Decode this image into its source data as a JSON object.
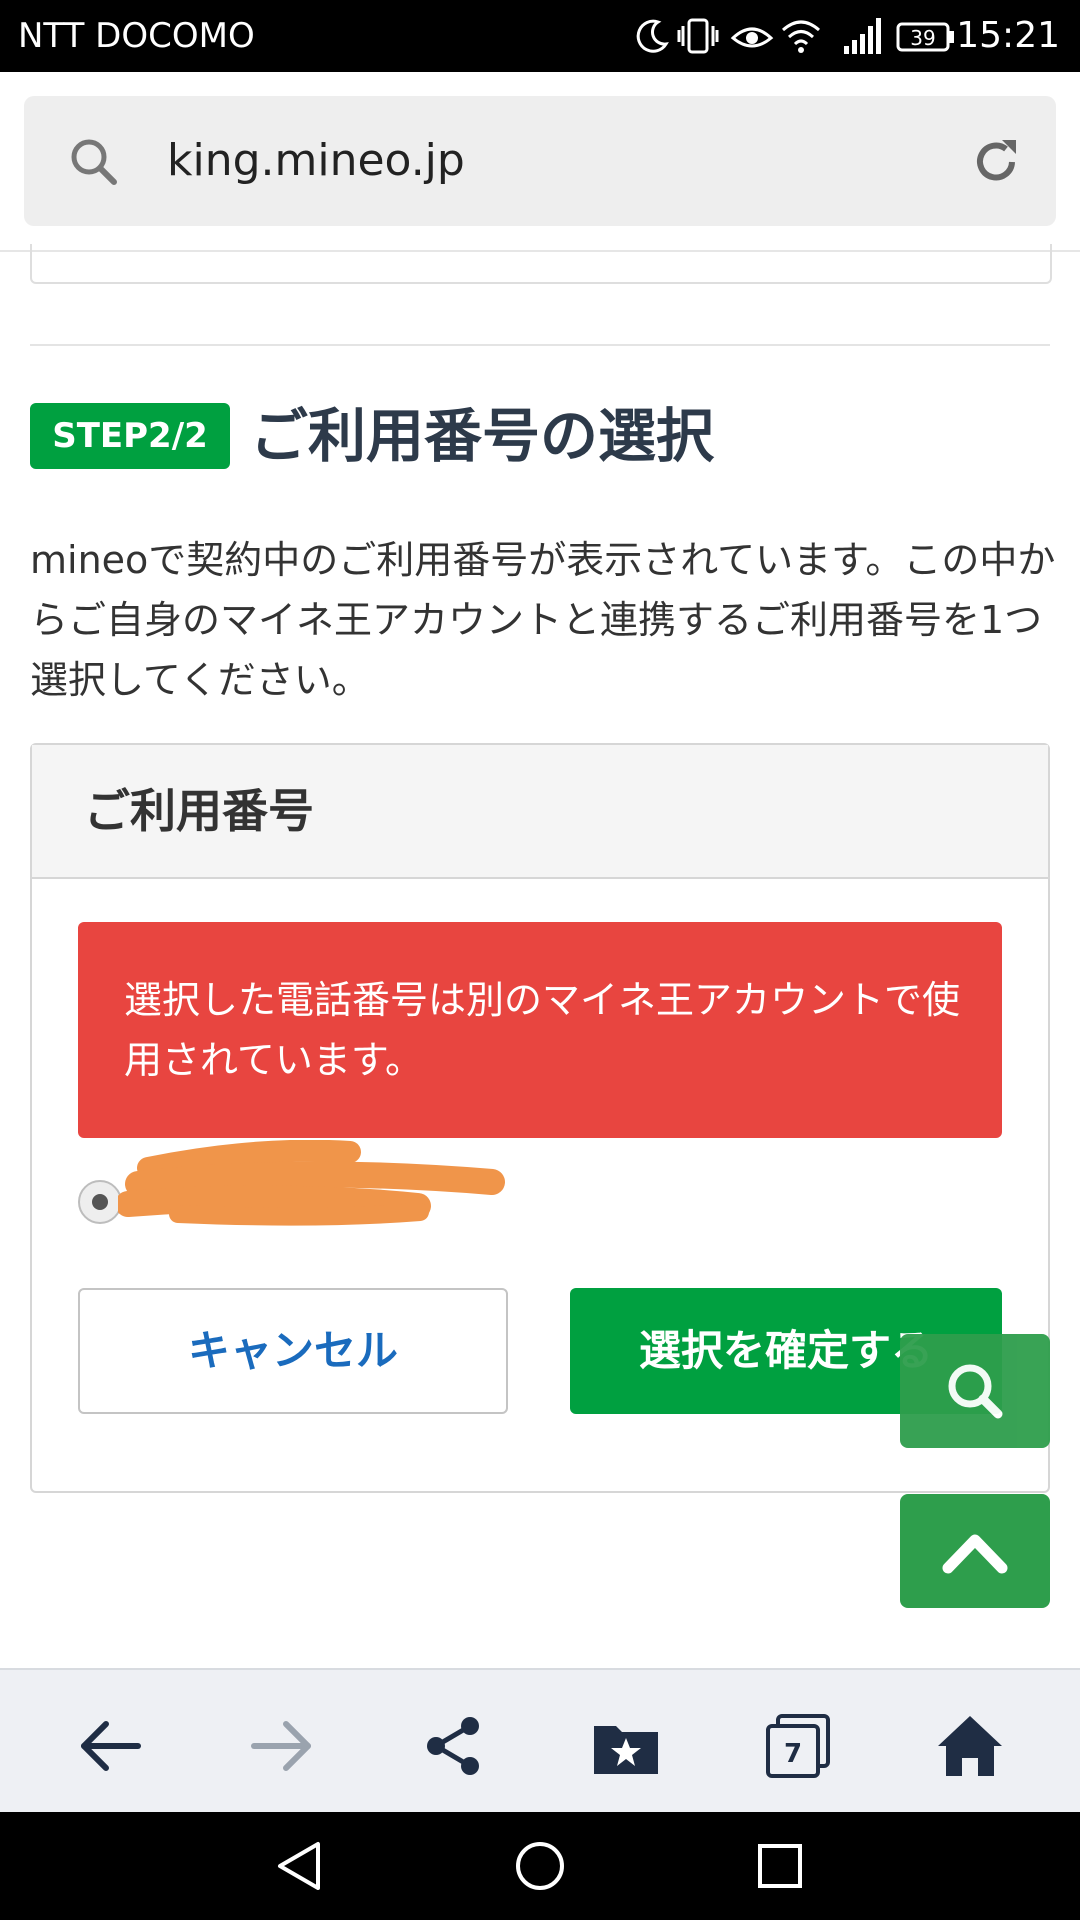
{
  "status_bar": {
    "carrier": "NTT DOCOMO",
    "battery": "39",
    "time": "15:21"
  },
  "browser": {
    "url": "king.mineo.jp",
    "tab_count": "7"
  },
  "step": {
    "badge": "STEP2/2",
    "title": "ご利用番号の選択"
  },
  "description": "mineoで契約中のご利用番号が表示されています。この中からご自身のマイネ王アカウントと連携するご利用番号を1つ選択してください。",
  "card": {
    "title": "ご利用番号",
    "alert": "選択した電話番号は別のマイネ王アカウントで使用されています。",
    "cancel_label": "キャンセル",
    "confirm_label": "選択を確定する"
  },
  "colors": {
    "accent_green": "#00a040",
    "alert_red": "#e84540",
    "link_blue": "#1a6bbd",
    "redaction_orange": "#f0954a"
  }
}
